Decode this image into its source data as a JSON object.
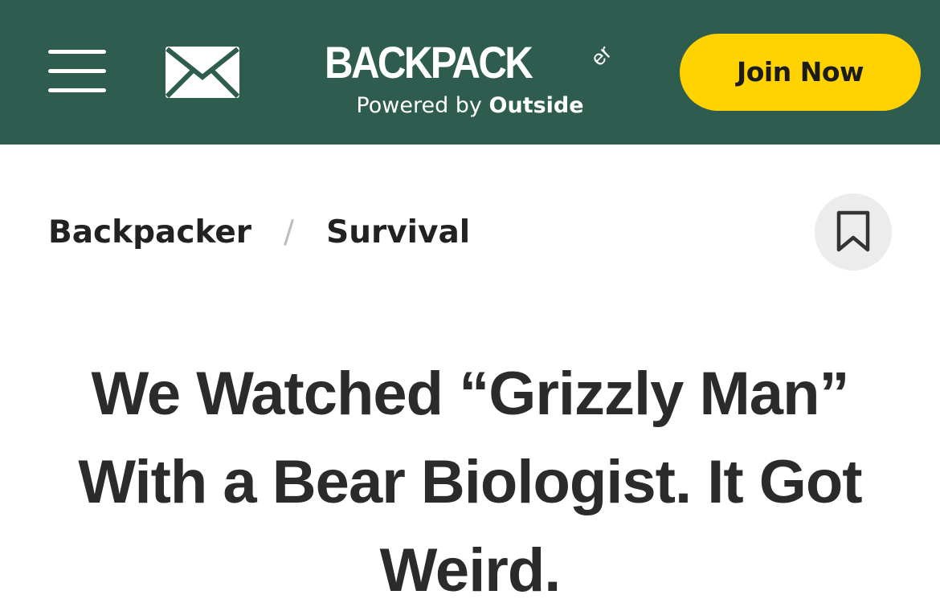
{
  "header": {
    "brand_name": "BACKPACK",
    "brand_suffix": "er",
    "brand_powered_by": "Powered by",
    "brand_owner": "Outside",
    "join_label": "Join Now",
    "colors": {
      "background": "#2e5c4f",
      "join_button": "#ffd200"
    },
    "icons": {
      "menu": "hamburger-menu-icon",
      "newsletter": "envelope-icon"
    }
  },
  "breadcrumb": {
    "items": [
      {
        "label": "Backpacker"
      },
      {
        "label": "Survival"
      }
    ],
    "separator": "/"
  },
  "bookmark": {
    "icon": "bookmark-icon"
  },
  "article": {
    "title": "We Watched “Grizzly Man” With a Bear Biologist. It Got Weird."
  }
}
